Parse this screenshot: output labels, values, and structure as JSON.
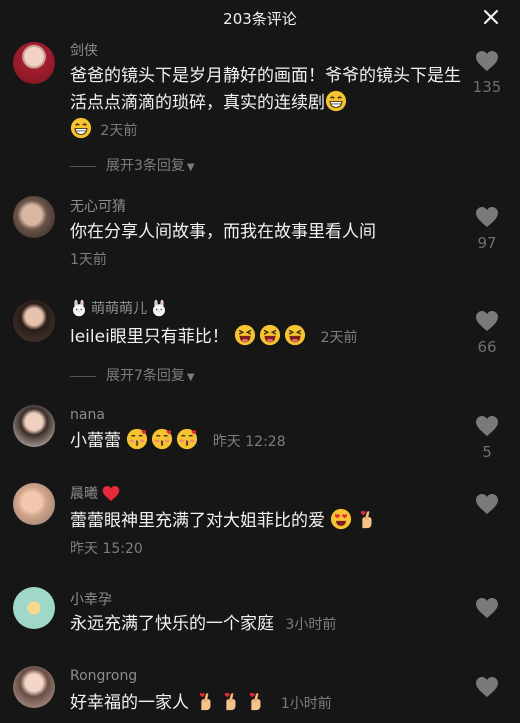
{
  "header": {
    "title": "203条评论"
  },
  "comments": [
    {
      "name": "剑侠",
      "text": "爸爸的镜头下是岁月静好的画面！爷爷的镜头下是生活点点滴滴的琐碎，真实的连续剧",
      "time": "2天前",
      "likes": "135",
      "replies": "展开3条回复"
    },
    {
      "name": "无心可猜",
      "text": "你在分享人间故事，而我在故事里看人间",
      "time": "1天前",
      "likes": "97"
    },
    {
      "name": "萌萌萌儿",
      "text": "leilei眼里只有菲比！",
      "time": "2天前",
      "likes": "66",
      "replies": "展开7条回复"
    },
    {
      "name": "nana",
      "text": "小蕾蕾",
      "time": "昨天 12:28",
      "likes": "5"
    },
    {
      "name": "晨曦",
      "text": "蕾蕾眼神里充满了对大姐菲比的爱",
      "time": "昨天 15:20",
      "likes": ""
    },
    {
      "name": "小幸孕",
      "text": "永远充满了快乐的一个家庭",
      "time": "3小时前",
      "likes": ""
    },
    {
      "name": "Rongrong",
      "text": "好幸福的一家人",
      "time": "1小时前",
      "likes": ""
    }
  ],
  "icons": {
    "close": "close-icon",
    "like": "heart-icon",
    "grin": "grinning-emoji-icon",
    "laugh": "laughing-emoji-icon",
    "kiss": "kissing-emoji-icon",
    "love": "heart-eyes-emoji-icon",
    "finger_heart": "finger-heart-icon",
    "rabbit": "rabbit-emoji-icon",
    "red_heart": "red-heart-icon"
  },
  "colors": {
    "background": "#161616",
    "text": "#f2f2f2",
    "muted": "#7d7d7d",
    "heart_red": "#e8283c",
    "emoji_yellow": "#f6c431"
  }
}
